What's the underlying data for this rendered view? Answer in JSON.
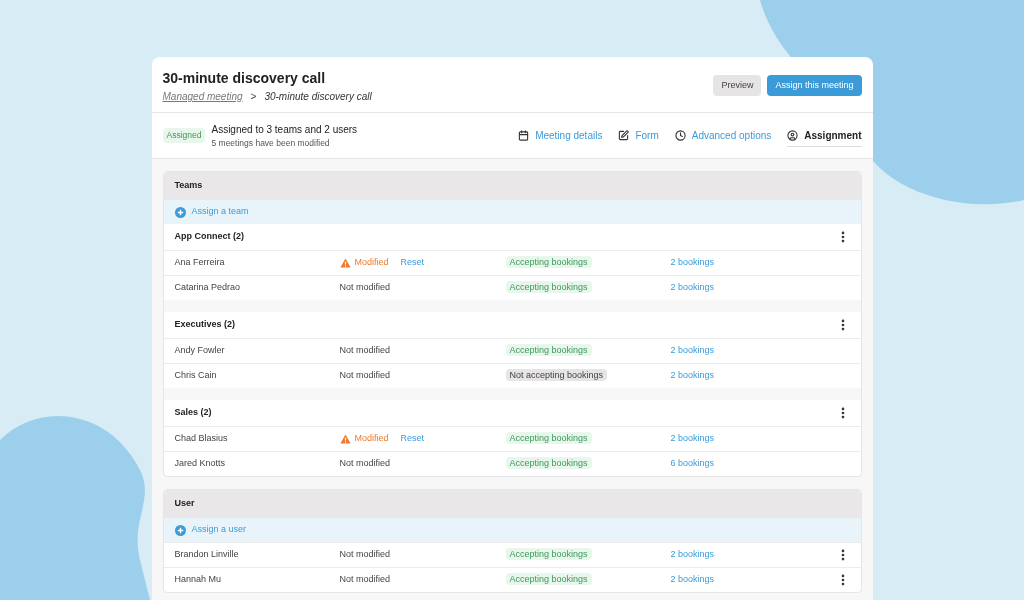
{
  "header": {
    "title": "30-minute discovery call",
    "breadcrumb": {
      "parent": "Managed meeting",
      "separator": ">",
      "current": "30-minute discovery call"
    },
    "buttons": [
      {
        "label": "Preview",
        "kind": "secondary"
      },
      {
        "label": "Assign this meeting",
        "kind": "primary"
      }
    ]
  },
  "summary": {
    "badge": "Assigned",
    "text": "Assigned to 3 teams and 2 users",
    "subtext": "5 meetings have been modified"
  },
  "nav": [
    {
      "label": "Meeting details",
      "selected": false
    },
    {
      "label": "Form",
      "selected": false
    },
    {
      "label": "Advanced options",
      "selected": false
    },
    {
      "label": "Assignment",
      "selected": true
    }
  ],
  "teams": {
    "title": "Teams",
    "action": "Assign a team",
    "groups": [
      {
        "name": "App Connect (2)",
        "members": [
          {
            "name": "Ana Ferreira",
            "modification": {
              "kind": "modified",
              "label": "Modified",
              "action": "Reset"
            },
            "status": {
              "label": "Accepting bookings",
              "accepting": true
            },
            "bookings": "2 bookings"
          },
          {
            "name": "Catarina Pedrao",
            "modification": {
              "kind": "unmodified",
              "label": "Not modified"
            },
            "status": {
              "label": "Accepting bookings",
              "accepting": true
            },
            "bookings": "2 bookings"
          }
        ]
      },
      {
        "name": "Executives (2)",
        "members": [
          {
            "name": "Andy Fowler",
            "modification": {
              "kind": "unmodified",
              "label": "Not modified"
            },
            "status": {
              "label": "Accepting bookings",
              "accepting": true
            },
            "bookings": "2 bookings"
          },
          {
            "name": "Chris Cain",
            "modification": {
              "kind": "unmodified",
              "label": "Not modified"
            },
            "status": {
              "label": "Not accepting bookings",
              "accepting": false
            },
            "bookings": "2 bookings"
          }
        ]
      },
      {
        "name": "Sales (2)",
        "members": [
          {
            "name": "Chad Blasius",
            "modification": {
              "kind": "modified",
              "label": "Modified",
              "action": "Reset"
            },
            "status": {
              "label": "Accepting bookings",
              "accepting": true
            },
            "bookings": "2 bookings"
          },
          {
            "name": "Jared Knotts",
            "modification": {
              "kind": "unmodified",
              "label": "Not modified"
            },
            "status": {
              "label": "Accepting bookings",
              "accepting": true
            },
            "bookings": "6 bookings"
          }
        ]
      }
    ]
  },
  "users": {
    "title": "User",
    "action": "Assign a user",
    "members": [
      {
        "name": "Brandon Linville",
        "modification": {
          "kind": "unmodified",
          "label": "Not modified"
        },
        "status": {
          "label": "Accepting bookings",
          "accepting": true
        },
        "bookings": "2 bookings"
      },
      {
        "name": "Hannah Mu",
        "modification": {
          "kind": "unmodified",
          "label": "Not modified"
        },
        "status": {
          "label": "Accepting bookings",
          "accepting": true
        },
        "bookings": "2 bookings"
      }
    ]
  }
}
